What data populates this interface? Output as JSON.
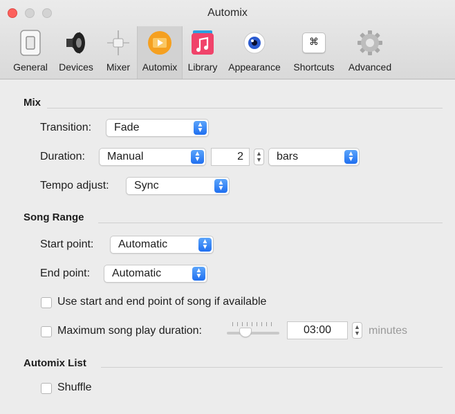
{
  "window": {
    "title": "Automix"
  },
  "toolbar": {
    "items": [
      {
        "label": "General",
        "icon": "switch-icon"
      },
      {
        "label": "Devices",
        "icon": "speaker-icon"
      },
      {
        "label": "Mixer",
        "icon": "mixer-icon"
      },
      {
        "label": "Automix",
        "icon": "automix-icon",
        "selected": true
      },
      {
        "label": "Library",
        "icon": "music-note-icon"
      },
      {
        "label": "Appearance",
        "icon": "eye-icon"
      },
      {
        "label": "Shortcuts",
        "icon": "command-key-icon"
      },
      {
        "label": "Advanced",
        "icon": "gear-icon"
      }
    ],
    "shortcuts_glyph": "⌘"
  },
  "mix": {
    "heading": "Mix",
    "transition_label": "Transition:",
    "transition_value": "Fade",
    "duration_label": "Duration:",
    "duration_mode": "Manual",
    "duration_amount": "2",
    "duration_unit": "bars",
    "tempo_label": "Tempo adjust:",
    "tempo_value": "Sync"
  },
  "song_range": {
    "heading": "Song Range",
    "start_label": "Start point:",
    "start_value": "Automatic",
    "end_label": "End point:",
    "end_value": "Automatic",
    "use_song_points_label": "Use start and end point of song if available",
    "use_song_points_checked": false,
    "max_duration_label": "Maximum song play duration:",
    "max_duration_checked": false,
    "max_duration_value": "03:00",
    "max_duration_unit": "minutes",
    "slider_level": 0.25
  },
  "automix_list": {
    "heading": "Automix List",
    "shuffle_label": "Shuffle",
    "shuffle_checked": false
  },
  "colors": {
    "accent": "#2a7df6",
    "automix_icon": "#f5a020",
    "library_icon": "#f0436a"
  }
}
